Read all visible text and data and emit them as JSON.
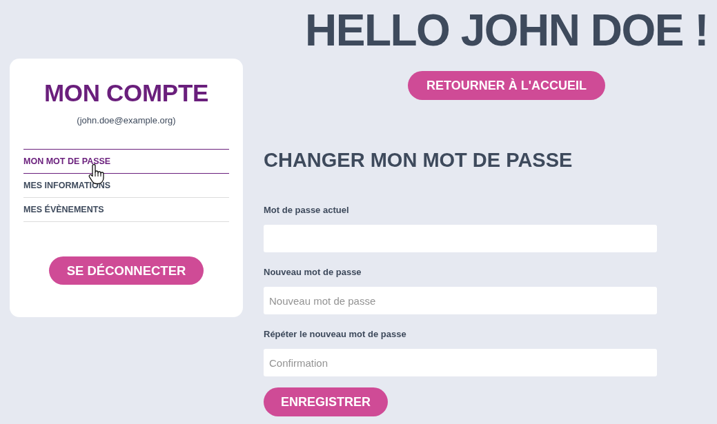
{
  "header": {
    "greeting": "HELLO JOHN DOE !",
    "home_button": "RETOURNER À L'ACCUEIL"
  },
  "sidebar": {
    "title": "MON COMPTE",
    "email": "(john.doe@example.org)",
    "items": [
      {
        "label": "MON MOT DE PASSE",
        "selected": true
      },
      {
        "label": "MES INFORMATIONS",
        "selected": false
      },
      {
        "label": "MES ÉVÈNEMENTS",
        "selected": false
      }
    ],
    "logout_button": "SE DÉCONNECTER"
  },
  "form": {
    "title": "CHANGER MON MOT DE PASSE",
    "fields": [
      {
        "label": "Mot de passe actuel"
      },
      {
        "label": "Nouveau mot de passe",
        "placeholder": "Nouveau mot de passe"
      },
      {
        "label": "Répéter le nouveau mot de passe",
        "placeholder": "Confirmation"
      }
    ],
    "submit_button": "ENREGISTRER"
  }
}
